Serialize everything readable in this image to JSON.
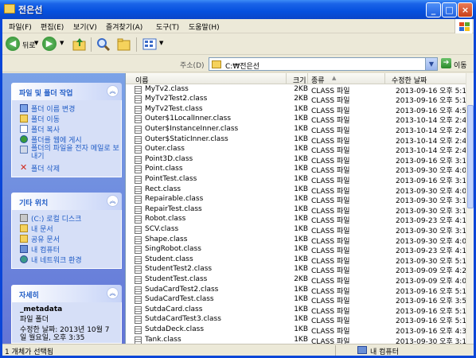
{
  "window": {
    "title": "전은선"
  },
  "menu": [
    "파일(F)",
    "편집(E)",
    "보기(V)",
    "즐겨찾기(A)",
    "도구(T)",
    "도움말(H)"
  ],
  "toolbar": {
    "back": "뒤로"
  },
  "address": {
    "label": "주소(D)",
    "value": "C:₩전은선",
    "go": "이동"
  },
  "tasks": {
    "title": "파일 및 폴더 작업",
    "items": [
      {
        "label": "폴더 이름 변경",
        "icon": "rename-icon"
      },
      {
        "label": "폴더 이동",
        "icon": "move-icon"
      },
      {
        "label": "폴더 복사",
        "icon": "copy-icon"
      },
      {
        "label": "폴더를 웹에 게시",
        "icon": "web-publish-icon"
      },
      {
        "label": "폴더의 파일을 전자 메일로 보내기",
        "icon": "email-icon"
      },
      {
        "label": "폴더 삭제",
        "icon": "delete-icon"
      }
    ]
  },
  "other": {
    "title": "기타 위치",
    "items": [
      {
        "label": "(C:) 로컬 디스크",
        "icon": "drive-icon"
      },
      {
        "label": "내 문서",
        "icon": "my-documents-icon"
      },
      {
        "label": "공유 문서",
        "icon": "shared-documents-icon"
      },
      {
        "label": "내 컴퓨터",
        "icon": "my-computer-icon"
      },
      {
        "label": "내 네트워크 환경",
        "icon": "network-icon"
      }
    ]
  },
  "details": {
    "title": "자세히",
    "name": "_metadata",
    "type": "파일 폴더",
    "modified": "수정한 날짜: 2013년 10월 7일 월요일, 오후 3:35"
  },
  "columns": {
    "name": "이름",
    "size": "크기",
    "type": "종류",
    "modified": "수정한 날짜"
  },
  "files": [
    {
      "name": "MyTv2.class",
      "size": "2KB",
      "type": "CLASS 파일",
      "modified": "2013-09-16 오후 5:1"
    },
    {
      "name": "MyTv2Test2.class",
      "size": "2KB",
      "type": "CLASS 파일",
      "modified": "2013-09-16 오후 5:1"
    },
    {
      "name": "MyTv2Test.class",
      "size": "1KB",
      "type": "CLASS 파일",
      "modified": "2013-09-16 오후 4:5"
    },
    {
      "name": "Outer$1LocalInner.class",
      "size": "1KB",
      "type": "CLASS 파일",
      "modified": "2013-10-14 오후 2:4"
    },
    {
      "name": "Outer$InstanceInner.class",
      "size": "1KB",
      "type": "CLASS 파일",
      "modified": "2013-10-14 오후 2:4"
    },
    {
      "name": "Outer$StaticInner.class",
      "size": "1KB",
      "type": "CLASS 파일",
      "modified": "2013-10-14 오후 2:4"
    },
    {
      "name": "Outer.class",
      "size": "1KB",
      "type": "CLASS 파일",
      "modified": "2013-10-14 오후 2:4"
    },
    {
      "name": "Point3D.class",
      "size": "1KB",
      "type": "CLASS 파일",
      "modified": "2013-09-16 오후 3:1"
    },
    {
      "name": "Point.class",
      "size": "1KB",
      "type": "CLASS 파일",
      "modified": "2013-09-30 오후 4:0"
    },
    {
      "name": "PointTest.class",
      "size": "1KB",
      "type": "CLASS 파일",
      "modified": "2013-09-16 오후 3:1"
    },
    {
      "name": "Rect.class",
      "size": "1KB",
      "type": "CLASS 파일",
      "modified": "2013-09-30 오후 4:0"
    },
    {
      "name": "Repairable.class",
      "size": "1KB",
      "type": "CLASS 파일",
      "modified": "2013-09-30 오후 3:1"
    },
    {
      "name": "RepairTest.class",
      "size": "1KB",
      "type": "CLASS 파일",
      "modified": "2013-09-30 오후 3:1"
    },
    {
      "name": "Robot.class",
      "size": "1KB",
      "type": "CLASS 파일",
      "modified": "2013-09-23 오후 4:1"
    },
    {
      "name": "SCV.class",
      "size": "1KB",
      "type": "CLASS 파일",
      "modified": "2013-09-30 오후 3:1"
    },
    {
      "name": "Shape.class",
      "size": "1KB",
      "type": "CLASS 파일",
      "modified": "2013-09-30 오후 4:0"
    },
    {
      "name": "SingRobot.class",
      "size": "1KB",
      "type": "CLASS 파일",
      "modified": "2013-09-23 오후 4:1"
    },
    {
      "name": "Student.class",
      "size": "1KB",
      "type": "CLASS 파일",
      "modified": "2013-09-30 오후 5:1"
    },
    {
      "name": "StudentTest2.class",
      "size": "1KB",
      "type": "CLASS 파일",
      "modified": "2013-09-09 오후 4:2"
    },
    {
      "name": "StudentTest.class",
      "size": "2KB",
      "type": "CLASS 파일",
      "modified": "2013-09-09 오후 4:0"
    },
    {
      "name": "SudaCardTest2.class",
      "size": "1KB",
      "type": "CLASS 파일",
      "modified": "2013-09-16 오후 5:1"
    },
    {
      "name": "SudaCardTest.class",
      "size": "1KB",
      "type": "CLASS 파일",
      "modified": "2013-09-16 오후 3:5"
    },
    {
      "name": "SutdaCard.class",
      "size": "1KB",
      "type": "CLASS 파일",
      "modified": "2013-09-16 오후 5:1"
    },
    {
      "name": "SutdaCardTest3.class",
      "size": "1KB",
      "type": "CLASS 파일",
      "modified": "2013-09-16 오후 5:1"
    },
    {
      "name": "SutdaDeck.class",
      "size": "1KB",
      "type": "CLASS 파일",
      "modified": "2013-09-16 오후 4:3"
    },
    {
      "name": "Tank.class",
      "size": "1KB",
      "type": "CLASS 파일",
      "modified": "2013-09-30 오후 3:1"
    }
  ],
  "status": {
    "left": "1 개체가 선택됨",
    "right": "내 컴퓨터"
  }
}
